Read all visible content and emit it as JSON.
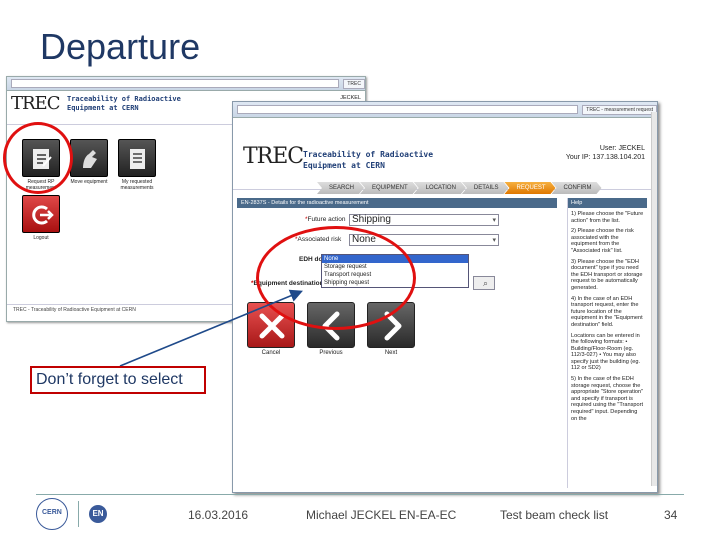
{
  "slide": {
    "title": "Departure",
    "callout": "Don’t forget to select",
    "footer": {
      "date": "16.03.2016",
      "author": "Michael JECKEL EN-EA-EC",
      "topic": "Test beam check list",
      "page": "34"
    }
  },
  "back_window": {
    "user": "JECKEL",
    "logo": "TREC",
    "logo_sub_1": "Traceability of Radioactive",
    "logo_sub_2": "Equipment at CERN",
    "menu": [
      {
        "label": "Request RP measurement"
      },
      {
        "label": "Move equipment"
      },
      {
        "label": "My requested measurements"
      },
      {
        "label": "Logout"
      }
    ],
    "footer": "TREC - Traceability of Radioactive Equipment at CERN"
  },
  "front_window": {
    "tab_label": "TREC - measurement request",
    "user_label": "User: JECKEL",
    "ip_label": "Your IP: 137.138.104.201",
    "logo": "TREC",
    "logo_sub_1": "Traceability of Radioactive",
    "logo_sub_2": "Equipment at CERN",
    "steps": [
      "SEARCH",
      "EQUIPMENT",
      "LOCATION",
      "DETAILS",
      "REQUEST",
      "CONFIRM"
    ],
    "form_title": "EN-2837S - Details for the radioactive measurement",
    "fields": {
      "future_action_label": "Future action",
      "future_action_value": "Shipping",
      "assoc_risk_label": "Associated risk",
      "assoc_risk_value": "None",
      "edh_label": "EDH document",
      "eq_dest_label": "Equipment destination"
    },
    "dropdown_options": [
      "None",
      "Storage request",
      "Transport request",
      "Shipping request"
    ],
    "buttons": {
      "cancel": "Cancel",
      "previous": "Previous",
      "next": "Next"
    },
    "help": {
      "title": "Help",
      "p1": "1) Please choose the \"Future action\" from the list.",
      "p2": "2) Please choose the risk associated with the equipment from the \"Associated risk\" list.",
      "p3": "3) Please choose the \"EDH document\" type if you need the EDH transport or storage request to be automatically generated.",
      "p4": "4) In the case of an EDH transport request, enter the future location of the equipment in the \"Equipment destination\" field.",
      "p5": "Locations can be entered in the following formats: • Building/Floor-Room (eg. 112/3-027) • You may also specify just the building (eg. 112 or SD2)",
      "p6": "5) In the case of the EDH storage request, choose the appropriate \"Store operation\" and specify if transport is required using the \"Transport required\" input. Depending on the"
    }
  }
}
